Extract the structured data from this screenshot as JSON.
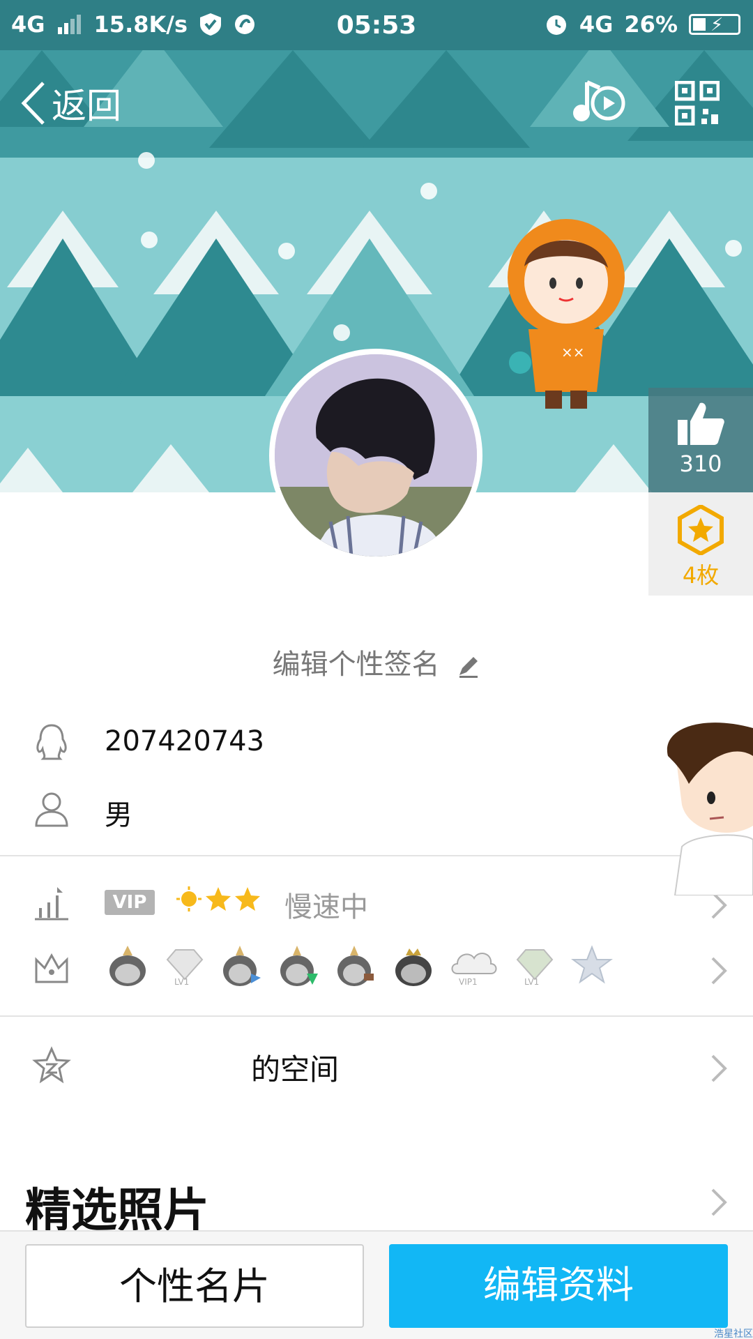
{
  "status_bar": {
    "network": "4G",
    "speed": "15.8K/s",
    "time": "05:53",
    "network_right": "4G",
    "battery": "26%"
  },
  "nav": {
    "back_label": "返回"
  },
  "profile": {
    "likes": "310",
    "medals": "4枚",
    "signature": "编辑个性签名",
    "qq_number": "207420743",
    "gender": "男"
  },
  "level": {
    "vip_tag": "VIP",
    "status": "慢速中"
  },
  "badges": [
    "LV1",
    "VIP1",
    "LV1"
  ],
  "space": {
    "label": "的空间"
  },
  "photos": {
    "title": "精选照片"
  },
  "buttons": {
    "card": "个性名片",
    "edit": "编辑资料"
  },
  "watermark": "浩星社区",
  "colors": {
    "primary_button": "#12b7f5",
    "cover_teal": "#86cdd0",
    "medal": "#f2a900"
  }
}
